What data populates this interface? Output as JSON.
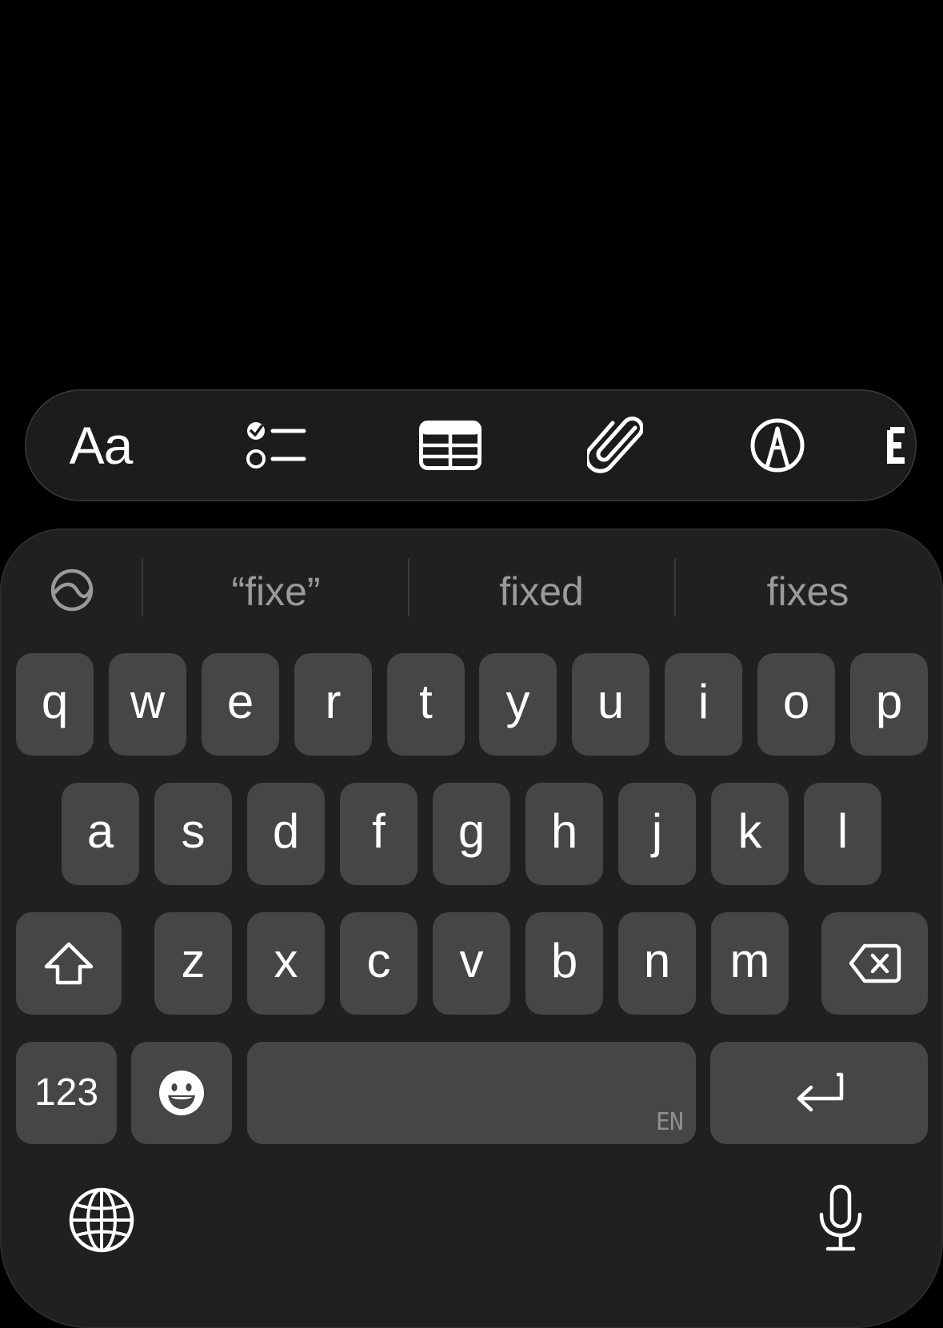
{
  "toolbar": {
    "format_label": "Aa",
    "items": [
      {
        "name": "format-text-button",
        "icon": "text-format-icon"
      },
      {
        "name": "checklist-button",
        "icon": "checklist-icon"
      },
      {
        "name": "table-button",
        "icon": "table-icon"
      },
      {
        "name": "attachment-button",
        "icon": "paperclip-icon"
      },
      {
        "name": "markup-button",
        "icon": "pen-circle-icon"
      },
      {
        "name": "more-button",
        "icon": "partially-visible-icon"
      }
    ]
  },
  "predictive": {
    "icon": "prediction-toggle-icon",
    "suggestions": [
      "“fixe”",
      "fixed",
      "fixes"
    ]
  },
  "keyboard": {
    "row1": [
      "q",
      "w",
      "e",
      "r",
      "t",
      "y",
      "u",
      "i",
      "o",
      "p"
    ],
    "row2": [
      "a",
      "s",
      "d",
      "f",
      "g",
      "h",
      "j",
      "k",
      "l"
    ],
    "row3": [
      "z",
      "x",
      "c",
      "v",
      "b",
      "n",
      "m"
    ],
    "numbers_label": "123",
    "space_language": "EN",
    "icons": {
      "shift": "shift-icon",
      "delete": "delete-icon",
      "emoji": "emoji-icon",
      "return": "return-icon",
      "globe": "globe-icon",
      "dictation": "microphone-icon"
    }
  },
  "colors": {
    "background": "#000000",
    "keyboard": "#202020",
    "key": "#464646",
    "toolbar": "#1c1c1e",
    "suggestion_text": "#9a9a9e"
  }
}
